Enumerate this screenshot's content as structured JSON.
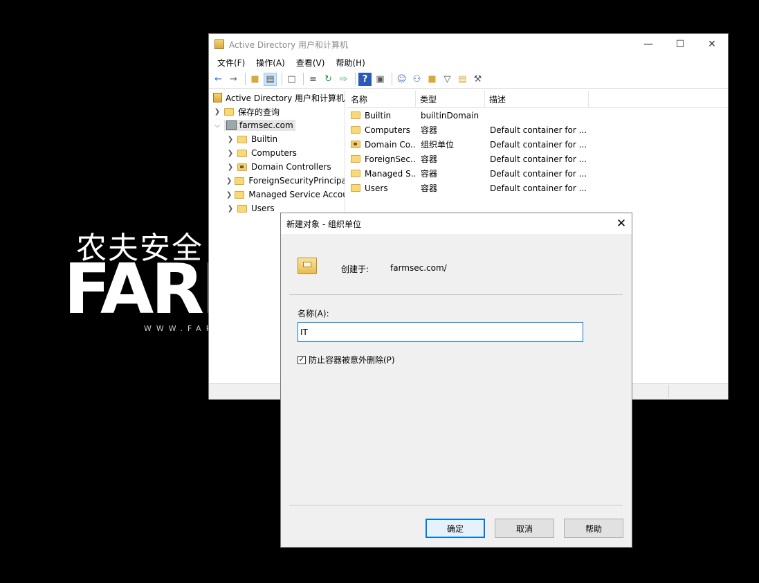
{
  "desktop": {
    "watermark_cn": "农夫安全",
    "watermark_big": "FARM",
    "watermark_url": "WWW.FAR"
  },
  "window": {
    "title": "Active Directory 用户和计算机",
    "controls": {
      "minimize": "—",
      "maximize": "☐",
      "close": "✕"
    },
    "menu": [
      "文件(F)",
      "操作(A)",
      "查看(V)",
      "帮助(H)"
    ],
    "toolbar_icons": [
      "back-arrow-icon",
      "forward-arrow-icon",
      "up-folder-icon",
      "console-tree-icon",
      "copy-icon",
      "properties-icon",
      "refresh-icon",
      "export-icon",
      "help-icon",
      "mmc-icon",
      "user-icon",
      "group-icon",
      "ou-icon",
      "filter-icon",
      "find-icon",
      "delegate-icon"
    ],
    "tree": {
      "root": "Active Directory 用户和计算机",
      "saved_queries": "保存的查询",
      "domain": "farmsec.com",
      "children": [
        "Builtin",
        "Computers",
        "Domain Controllers",
        "ForeignSecurityPrincipals",
        "Managed Service Accounts",
        "Users"
      ]
    },
    "list": {
      "headers": [
        "名称",
        "类型",
        "描述"
      ],
      "rows": [
        {
          "name": "Builtin",
          "type": "builtinDomain",
          "desc": "",
          "ou": false
        },
        {
          "name": "Computers",
          "type": "容器",
          "desc": "Default container for ...",
          "ou": false
        },
        {
          "name": "Domain Co...",
          "type": "组织单位",
          "desc": "Default container for ...",
          "ou": true
        },
        {
          "name": "ForeignSec...",
          "type": "容器",
          "desc": "Default container for ...",
          "ou": false
        },
        {
          "name": "Managed S...",
          "type": "容器",
          "desc": "Default container for ...",
          "ou": false
        },
        {
          "name": "Users",
          "type": "容器",
          "desc": "Default container for ...",
          "ou": false
        }
      ]
    }
  },
  "dialog": {
    "title": "新建对象 - 组织单位",
    "close": "✕",
    "created_in_label": "创建于:",
    "created_in_value": "farmsec.com/",
    "name_label": "名称(A):",
    "name_value": "IT",
    "protect_label": "防止容器被意外删除(P)",
    "protect_checked": true,
    "ok": "确定",
    "cancel": "取消",
    "help": "帮助"
  }
}
